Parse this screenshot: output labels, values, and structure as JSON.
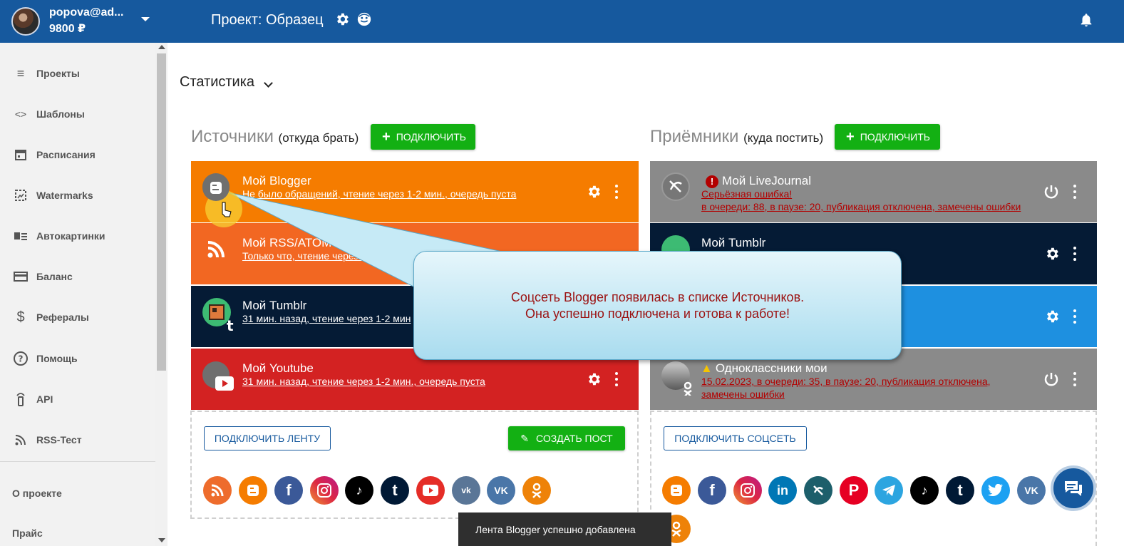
{
  "topbar": {
    "user_name": "popova@ad...",
    "balance": "9800 ₽",
    "project_title": "Проект: Образец"
  },
  "sidebar": {
    "items": [
      {
        "label": "Проекты",
        "icon": "list-icon"
      },
      {
        "label": "Шаблоны",
        "icon": "code-icon"
      },
      {
        "label": "Расписания",
        "icon": "calendar-icon"
      },
      {
        "label": "Watermarks",
        "icon": "watermark-icon"
      },
      {
        "label": "Автокартинки",
        "icon": "autoimage-icon"
      },
      {
        "label": "Баланс",
        "icon": "card-icon"
      },
      {
        "label": "Рефералы",
        "icon": "dollar-icon"
      },
      {
        "label": "Помощь",
        "icon": "help-icon"
      },
      {
        "label": "API",
        "icon": "api-icon"
      },
      {
        "label": "RSS-Тест",
        "icon": "rss-icon"
      }
    ],
    "about": "О проекте",
    "price": "Прайс"
  },
  "main": {
    "stats_label": "Статистика",
    "sources": {
      "title": "Источники",
      "subtitle": "(откуда брать)",
      "connect_label": "ПОДКЛЮЧИТЬ",
      "cards": [
        {
          "title": "Мой Blogger",
          "sub": "Не было обращений, чтение через 1-2 мин., очередь пуста",
          "color": "#f57c00"
        },
        {
          "title": "Мой RSS/ATOM",
          "sub": "Только что, чтение через 29 мин., в оч",
          "color": "#f26722"
        },
        {
          "title": "Мой Tumblr",
          "sub": "31 мин. назад, чтение через 1-2 мин",
          "color": "#051b35"
        },
        {
          "title": "Мой Youtube",
          "sub": "31 мин. назад, чтение через 1-2 мин., очередь пуста",
          "color": "#d32222"
        }
      ],
      "connect_feed_label": "ПОДКЛЮЧИТЬ ЛЕНТУ",
      "create_post_label": "СОЗДАТЬ ПОСТ"
    },
    "receivers": {
      "title": "Приёмники",
      "subtitle": "(куда постить)",
      "connect_label": "ПОДКЛЮЧИТЬ",
      "cards": [
        {
          "title": "Мой LiveJournal",
          "err1": "Серьёзная ошибка!",
          "err2": "в очереди: 88, в паузе: 20, публикация отключена, замечены ошибки",
          "color": "#8a8a8a"
        },
        {
          "title": "Мой Tumblr",
          "color": "#051b35"
        },
        {
          "title": "",
          "color": "#1e90e0"
        },
        {
          "title": "Одноклассники мои",
          "err1": "15.02.2023, в очереди: 35, в паузе: 20, публикация отключена,",
          "err2": "замечены ошибки",
          "color": "#8a8a8a"
        }
      ],
      "connect_social_label": "ПОДКЛЮЧИТЬ СОЦСЕТЬ"
    }
  },
  "tooltip": {
    "line1": "Соцсеть Blogger появилась в списке Источников.",
    "line2": "Она успешно подключена и готова к работе!"
  },
  "toast": "Лента Blogger успешно добавлена",
  "colors": {
    "topbar": "#16599e",
    "green": "#13b013",
    "blogger": "#f57c00",
    "facebook": "#3b5998",
    "instagram": "#d6249f",
    "tiktok": "#000000",
    "tumblr": "#001935",
    "youtube": "#e52d27",
    "vk": "#4a76a8",
    "ok": "#ee8208",
    "linkedin": "#0077b5",
    "livejournal": "#1d5f6b",
    "pinterest": "#e60023",
    "telegram": "#2ca5e0",
    "twitter": "#1da1f2"
  }
}
